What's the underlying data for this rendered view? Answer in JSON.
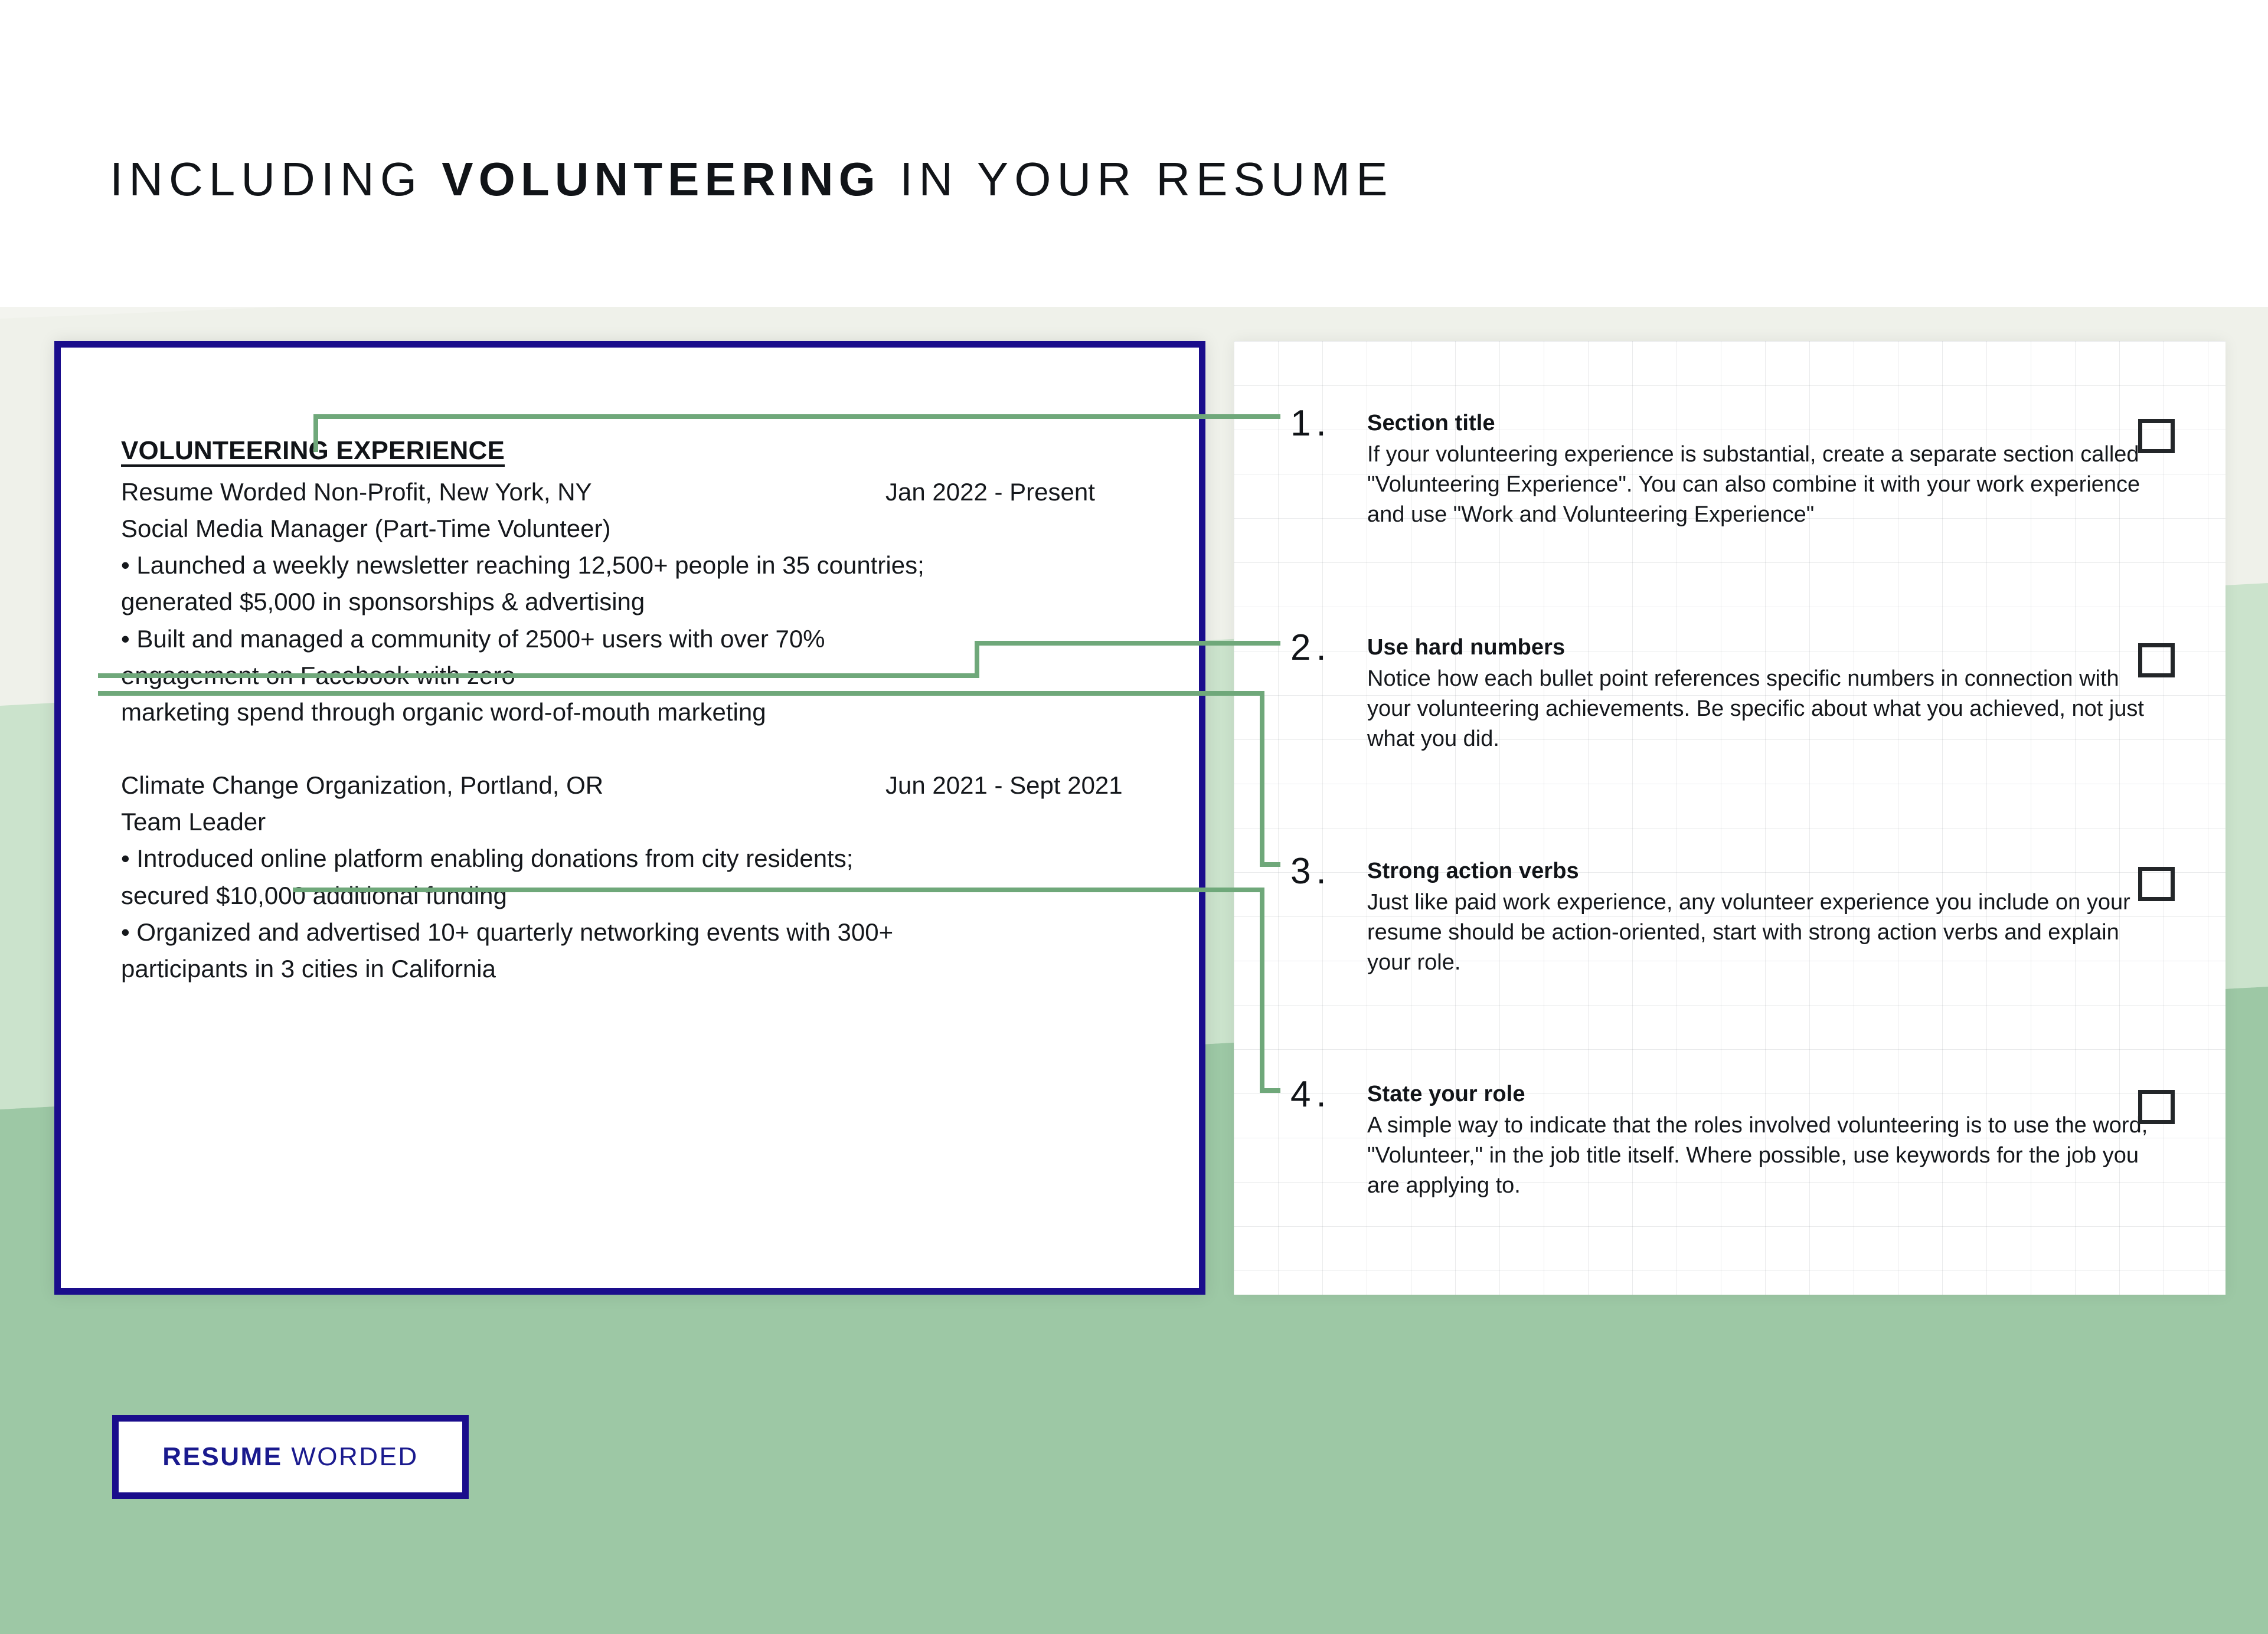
{
  "header": {
    "title_pre": "INCLUDING ",
    "title_highlight": "VOLUNTEERING",
    "title_post": " IN YOUR RESUME"
  },
  "resume": {
    "section_heading": "VOLUNTEERING EXPERIENCE",
    "entries": [
      {
        "organization": "Resume Worded Non-Profit, New York, NY",
        "dates": "Jan 2022 - Present",
        "role": "Social Media Manager (Part-Time Volunteer)",
        "bullets": [
          "• Launched a weekly newsletter reaching 12,500+ people in 35 countries;",
          "generated $5,000 in sponsorships & advertising",
          "• Built and managed a community of 2500+ users with over 70%",
          "engagement on Facebook with zero",
          "marketing spend through organic word-of-mouth marketing"
        ]
      },
      {
        "organization": "Climate Change Organization, Portland, OR",
        "dates": "Jun 2021 - Sept 2021",
        "role": "Team Leader",
        "bullets": [
          "• Introduced online platform enabling donations from city residents;",
          "secured $10,000 additional funding",
          "• Organized and advertised 10+ quarterly networking events with 300+",
          "participants in 3 cities in California"
        ]
      }
    ]
  },
  "tips": [
    {
      "number": "1.",
      "title": "Section title",
      "description": "If your volunteering experience is substantial, create a separate section called \"Volunteering Experience\". You can also combine it with your work experience and use \"Work and Volunteering Experience\"",
      "checkbox_checked": false
    },
    {
      "number": "2.",
      "title": "Use hard numbers",
      "description": "Notice how each bullet point references specific numbers in connection with your volunteering achievements. Be specific about what you achieved, not just what you did.",
      "checkbox_checked": false
    },
    {
      "number": "3.",
      "title": "Strong action verbs",
      "description": "Just like paid work experience, any volunteer experience you include on your resume should be action-oriented, start with strong action verbs and explain your role.",
      "checkbox_checked": false
    },
    {
      "number": "4.",
      "title": "State your role",
      "description": "A simple way to indicate that the roles involved volunteering is to use the word, \"Volunteer,\" in the job title itself. Where possible, use keywords for the job you are applying to.",
      "checkbox_checked": false
    }
  ],
  "logo": {
    "bold_part": "RESUME",
    "regular_part": " WORDED"
  },
  "colors": {
    "navy": "#1a0d8c",
    "green_connector": "#6fa87a",
    "background_green": "#9dc8a5",
    "background_green_light": "#cbe3cc",
    "text_dark": "#111418"
  }
}
